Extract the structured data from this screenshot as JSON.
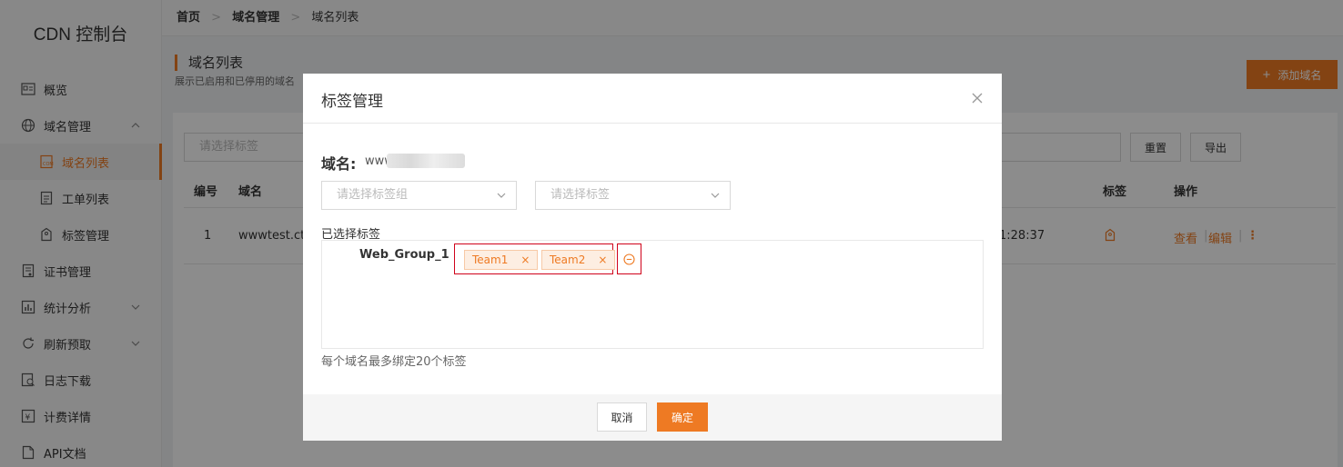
{
  "sidebar": {
    "brand": "CDN 控制台",
    "items": [
      {
        "label": "概览",
        "icon": "overview-icon"
      },
      {
        "label": "域名管理",
        "icon": "globe-icon"
      },
      {
        "label": "域名列表",
        "icon": "domain-list-icon"
      },
      {
        "label": "工单列表",
        "icon": "document-icon"
      },
      {
        "label": "标签管理",
        "icon": "tag-icon"
      },
      {
        "label": "证书管理",
        "icon": "certificate-icon"
      },
      {
        "label": "统计分析",
        "icon": "stats-icon"
      },
      {
        "label": "刷新预取",
        "icon": "refresh-icon"
      },
      {
        "label": "日志下载",
        "icon": "log-icon"
      },
      {
        "label": "计费详情",
        "icon": "yen-icon"
      },
      {
        "label": "API文档",
        "icon": "api-doc-icon"
      }
    ]
  },
  "breadcrumb": [
    "首页",
    "域名管理",
    "域名列表"
  ],
  "page": {
    "title": "域名列表",
    "description": "展示已启用和已停用的域名",
    "add_button": "添加域名"
  },
  "filter": {
    "tag_placeholder": "请选择标签",
    "reset": "重置",
    "export": "导出"
  },
  "table": {
    "headers": {
      "id": "编号",
      "domain": "域名",
      "tag": "标签",
      "actions": "操作"
    },
    "rows": [
      {
        "id": "1",
        "domain": "wwwtest.ctc",
        "time": "1:28:37",
        "view": "查看",
        "edit": "编辑"
      }
    ]
  },
  "modal": {
    "title": "标签管理",
    "domain_label": "域名:",
    "domain_value": "www",
    "tag_group_placeholder": "请选择标签组",
    "tag_placeholder": "请选择标签",
    "selected_label": "已选择标签",
    "group_name": "Web_Group_1",
    "tags": [
      "Team1",
      "Team2"
    ],
    "hint": "每个域名最多绑定20个标签",
    "cancel": "取消",
    "confirm": "确定"
  },
  "colors": {
    "accent": "#ee7a23",
    "highlight": "#d0021b"
  }
}
